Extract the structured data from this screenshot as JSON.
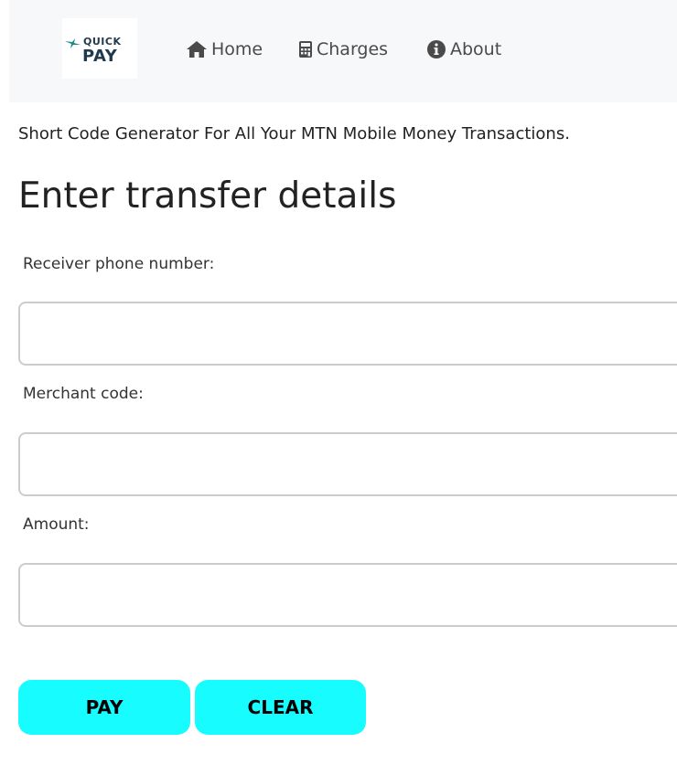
{
  "brand": {
    "logo_top": "QUICK",
    "logo_bottom": "PAY",
    "accent": "#17fcff"
  },
  "nav": {
    "items": [
      {
        "label": "Home",
        "icon": "home-icon"
      },
      {
        "label": "Charges",
        "icon": "calculator-icon"
      },
      {
        "label": "About",
        "icon": "info-circle-icon"
      }
    ]
  },
  "tagline": "Short Code Generator For All Your MTN Mobile Money Transactions.",
  "form": {
    "title": "Enter transfer details",
    "fields": [
      {
        "label": "Receiver phone number:",
        "value": "",
        "placeholder": ""
      },
      {
        "label": "Merchant code:",
        "value": "",
        "placeholder": ""
      },
      {
        "label": "Amount:",
        "value": "",
        "placeholder": ""
      }
    ],
    "pay_label": "PAY",
    "clear_label": "CLEAR"
  }
}
